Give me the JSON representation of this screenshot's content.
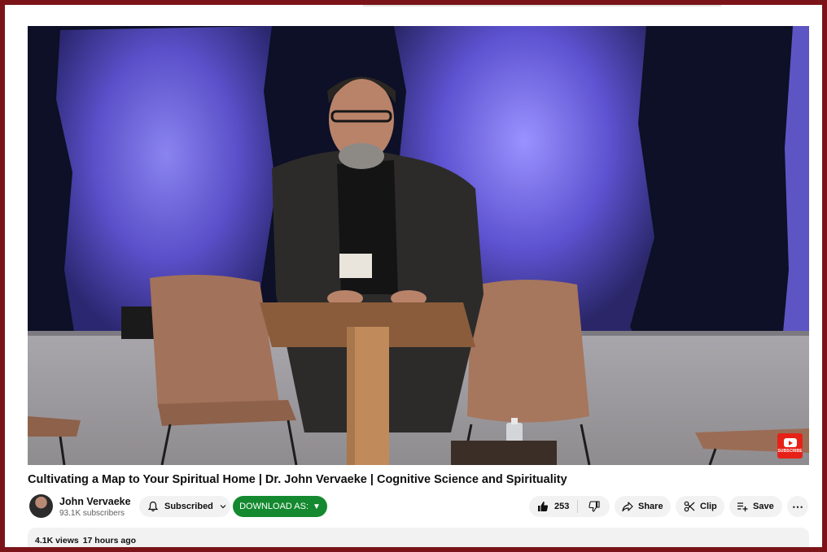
{
  "video": {
    "title": "Cultivating a Map to Your Spiritual Home | Dr. John Vervaeke | Cognitive Science and Spirituality",
    "watermark_label": "SUBSCRIBE"
  },
  "channel": {
    "name": "John Vervaeke",
    "subscribers": "93.1K subscribers",
    "avatar_icon": "avatar-icon"
  },
  "actions": {
    "subscribed_label": "Subscribed",
    "download_label": "DOWNLOAD AS:",
    "download_arrow": "▼",
    "like_count": "253",
    "share_label": "Share",
    "clip_label": "Clip",
    "save_label": "Save",
    "more_label": "⋯"
  },
  "description": {
    "views": "4.1K views",
    "uploaded": "17 hours ago"
  },
  "colors": {
    "frame": "#7a1418",
    "download_button": "#14892f",
    "yt_red": "#e62117",
    "stage_light": "#6a5ce0"
  }
}
